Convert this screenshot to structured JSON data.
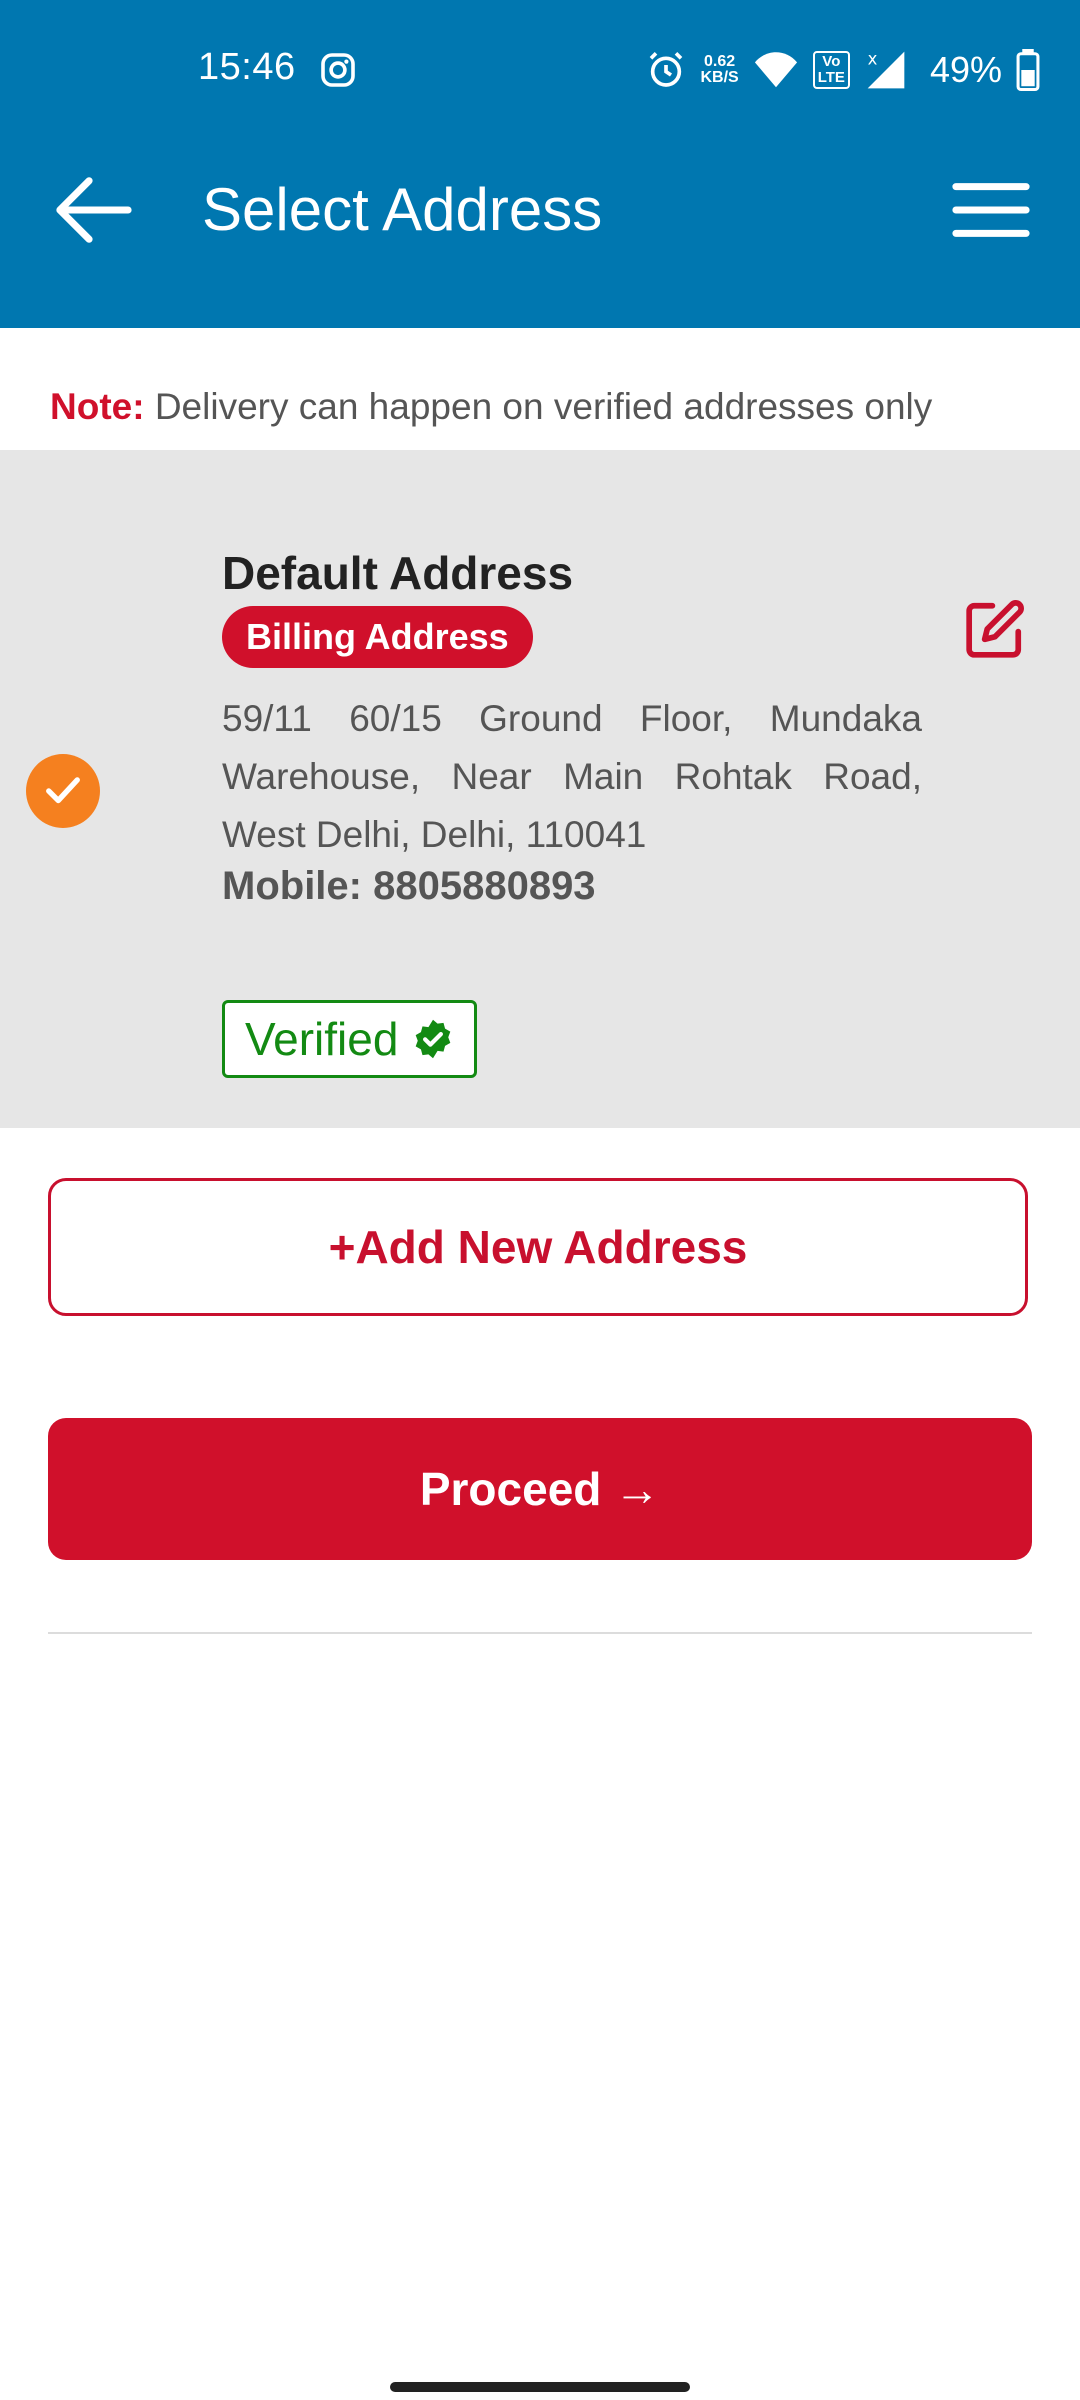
{
  "status_bar": {
    "time": "15:46",
    "speed_value": "0.62",
    "speed_unit": "KB/S",
    "network_label_top": "Vo",
    "network_label_bottom": "LTE",
    "battery": "49%",
    "icons": [
      "instagram-icon",
      "alarm-icon",
      "wifi-icon",
      "volte-icon",
      "signal-icon",
      "battery-icon"
    ]
  },
  "header": {
    "title": "Select Address",
    "color": "#0077b0"
  },
  "note": {
    "label": "Note:",
    "text": "Delivery can happen on verified addresses only"
  },
  "address_card": {
    "title": "Default Address",
    "badge": "Billing Address",
    "address": "59/11 60/15 Ground Floor, Mundaka Warehouse, Near Main Rohtak Road, West Delhi, Delhi, 110041",
    "mobile": "Mobile: 8805880893",
    "verified": "Verified",
    "selected": true
  },
  "actions": {
    "add_new": "+Add New Address",
    "proceed": "Proceed →"
  },
  "colors": {
    "accent_red": "#d0102b",
    "selection_orange": "#f5801f",
    "verified_green": "#138a13"
  }
}
